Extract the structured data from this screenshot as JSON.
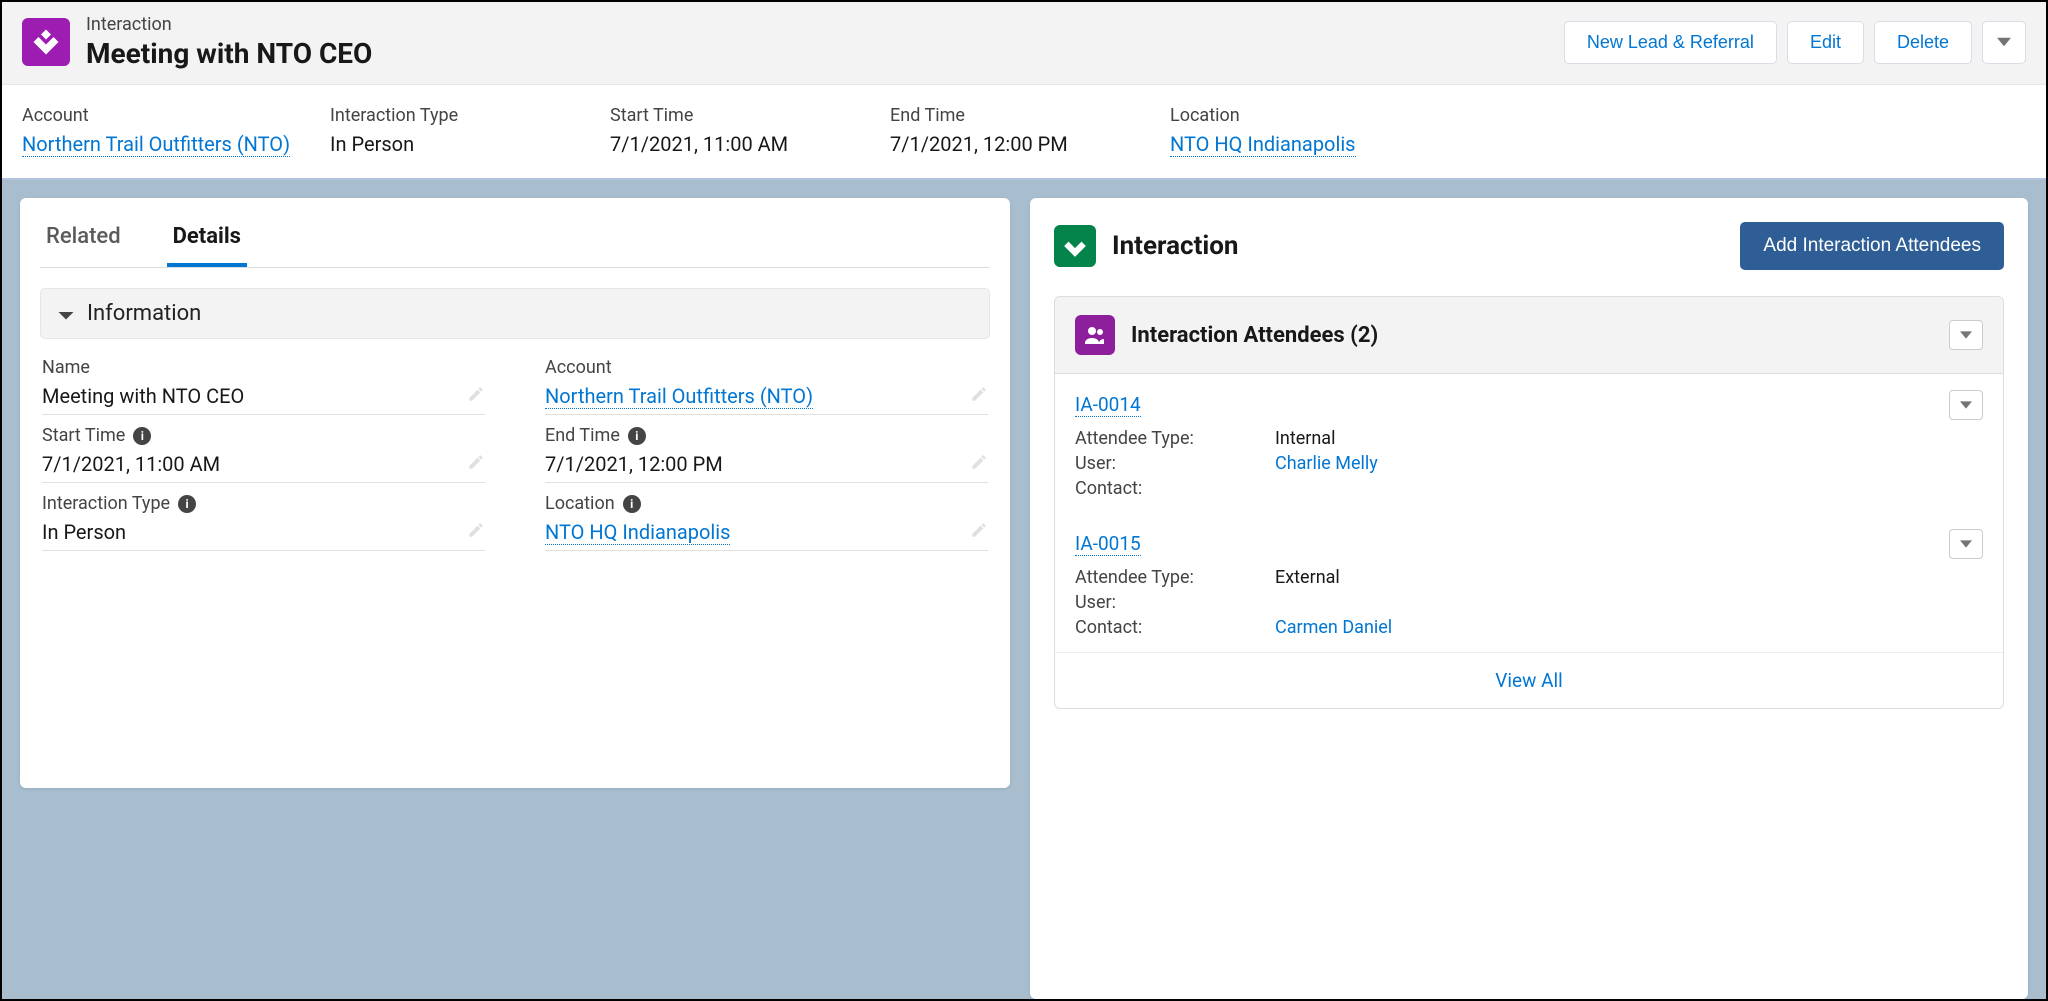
{
  "header": {
    "object_type": "Interaction",
    "object_name": "Meeting with NTO CEO",
    "actions": {
      "new_lead": "New Lead & Referral",
      "edit": "Edit",
      "delete": "Delete"
    }
  },
  "highlights": {
    "account_label": "Account",
    "account_value": "Northern Trail Outfitters (NTO)",
    "type_label": "Interaction Type",
    "type_value": "In Person",
    "start_label": "Start Time",
    "start_value": "7/1/2021, 11:00 AM",
    "end_label": "End Time",
    "end_value": "7/1/2021, 12:00 PM",
    "location_label": "Location",
    "location_value": "NTO HQ Indianapolis"
  },
  "tabs": {
    "related": "Related",
    "details": "Details"
  },
  "section_information": "Information",
  "details": {
    "name_label": "Name",
    "name_value": "Meeting with NTO CEO",
    "account_label": "Account",
    "account_value": "Northern Trail Outfitters (NTO)",
    "start_label": "Start Time",
    "start_value": "7/1/2021, 11:00 AM",
    "end_label": "End Time",
    "end_value": "7/1/2021, 12:00 PM",
    "type_label": "Interaction Type",
    "type_value": "In Person",
    "location_label": "Location",
    "location_value": "NTO HQ Indianapolis"
  },
  "right": {
    "title": "Interaction",
    "add_button": "Add Interaction Attendees",
    "card_title": "Interaction Attendees (2)",
    "labels": {
      "attendee_type": "Attendee Type:",
      "user": "User:",
      "contact": "Contact:"
    },
    "attendees": [
      {
        "id": "IA-0014",
        "type": "Internal",
        "user": "Charlie Melly",
        "contact": ""
      },
      {
        "id": "IA-0015",
        "type": "External",
        "user": "",
        "contact": "Carmen Daniel"
      }
    ],
    "view_all": "View All"
  }
}
